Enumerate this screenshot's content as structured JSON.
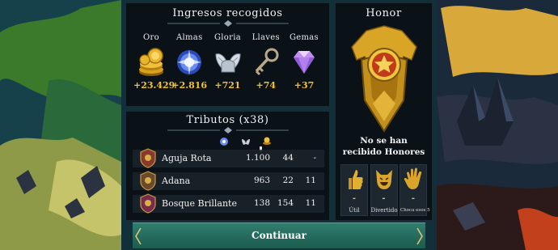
{
  "income": {
    "title": "Ingresos recogidos",
    "resources": [
      {
        "name": "Oro",
        "value": "+23.429",
        "icon": "gold-coins-icon"
      },
      {
        "name": "Almas",
        "value": "+2.816",
        "icon": "soul-orb-icon"
      },
      {
        "name": "Gloria",
        "value": "+721",
        "icon": "winged-helmet-icon"
      },
      {
        "name": "Llaves",
        "value": "+74",
        "icon": "key-icon"
      },
      {
        "name": "Gemas",
        "value": "+37",
        "icon": "gem-icon"
      }
    ]
  },
  "tributes": {
    "title": "Tributos (x38)",
    "column_icons": [
      "soul-icon",
      "glory-icon",
      "gold-icon"
    ],
    "rows": [
      {
        "name": "Aguja Rota",
        "values": [
          "1.100",
          "44",
          "-"
        ]
      },
      {
        "name": "Adana",
        "values": [
          "963",
          "22",
          "11"
        ]
      },
      {
        "name": "Bosque Brillante",
        "values": [
          "138",
          "154",
          "11"
        ]
      }
    ]
  },
  "honor": {
    "title": "Honor",
    "message_line1": "No se han",
    "message_line2": "recibido Honores",
    "cards": [
      {
        "label": "Útil",
        "value": "-",
        "icon": "thumbs-up-icon"
      },
      {
        "label": "Divertido",
        "value": "-",
        "icon": "laughing-face-icon"
      },
      {
        "label": "Choca esos 5",
        "value": "-",
        "icon": "high-five-icon"
      }
    ]
  },
  "continue_label": "Continuar",
  "colors": {
    "accent_gold": "#f1c232",
    "button_green": "#2a6f60",
    "panel_bg": "#0a1016"
  }
}
